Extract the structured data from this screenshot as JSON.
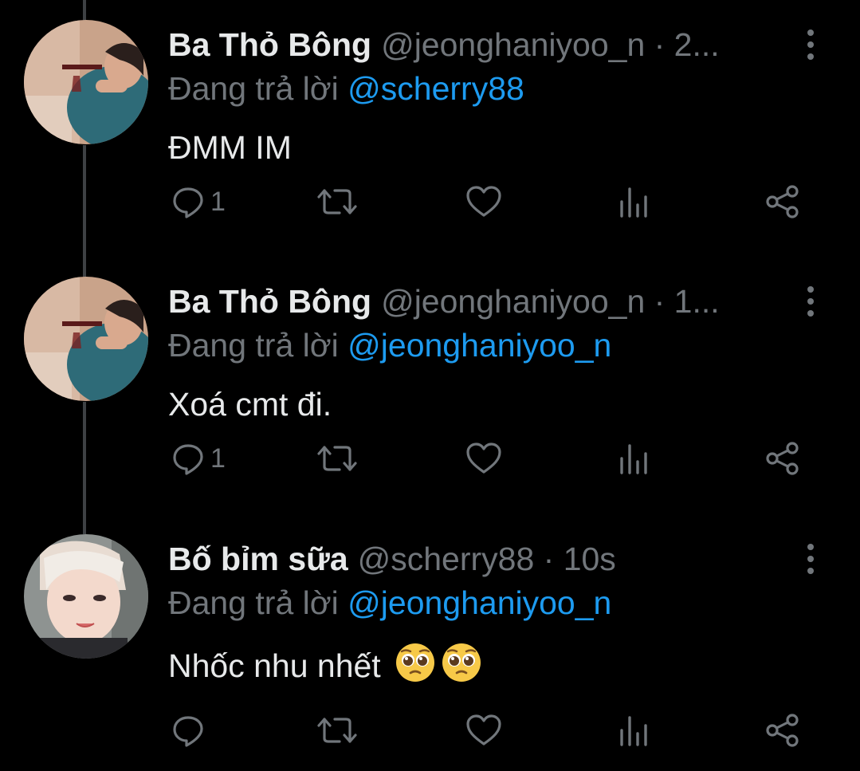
{
  "colors": {
    "background": "#000000",
    "text_primary": "#e7e9ea",
    "text_secondary": "#71767b",
    "link": "#1d9bf0",
    "thread_line": "#3e4144"
  },
  "tweets": [
    {
      "display_name": "Ba Thỏ Bông",
      "handle_time": "@jeonghaniyoo_n · 2...",
      "reply_prefix": "Đang trả lời",
      "reply_to": "@scherry88",
      "text": "ĐMM IM",
      "reply_count": "1",
      "emojis": []
    },
    {
      "display_name": "Ba Thỏ Bông",
      "handle_time": "@jeonghaniyoo_n · 1...",
      "reply_prefix": "Đang trả lời",
      "reply_to": "@jeonghaniyoo_n",
      "text": "Xoá cmt đi.",
      "reply_count": "1",
      "emojis": []
    },
    {
      "display_name": "Bố bỉm sữa",
      "handle_time": "@scherry88 · 10s",
      "reply_prefix": "Đang trả lời",
      "reply_to": "@jeonghaniyoo_n",
      "text": "Nhốc nhu nhết",
      "reply_count": "",
      "emojis": [
        "pleading-face",
        "pleading-face"
      ]
    }
  ],
  "icons": {
    "reply": "reply-bubble-icon",
    "retweet": "retweet-icon",
    "like": "heart-icon",
    "views": "views-chart-icon",
    "share": "share-icon",
    "more": "more-vertical-icon"
  }
}
